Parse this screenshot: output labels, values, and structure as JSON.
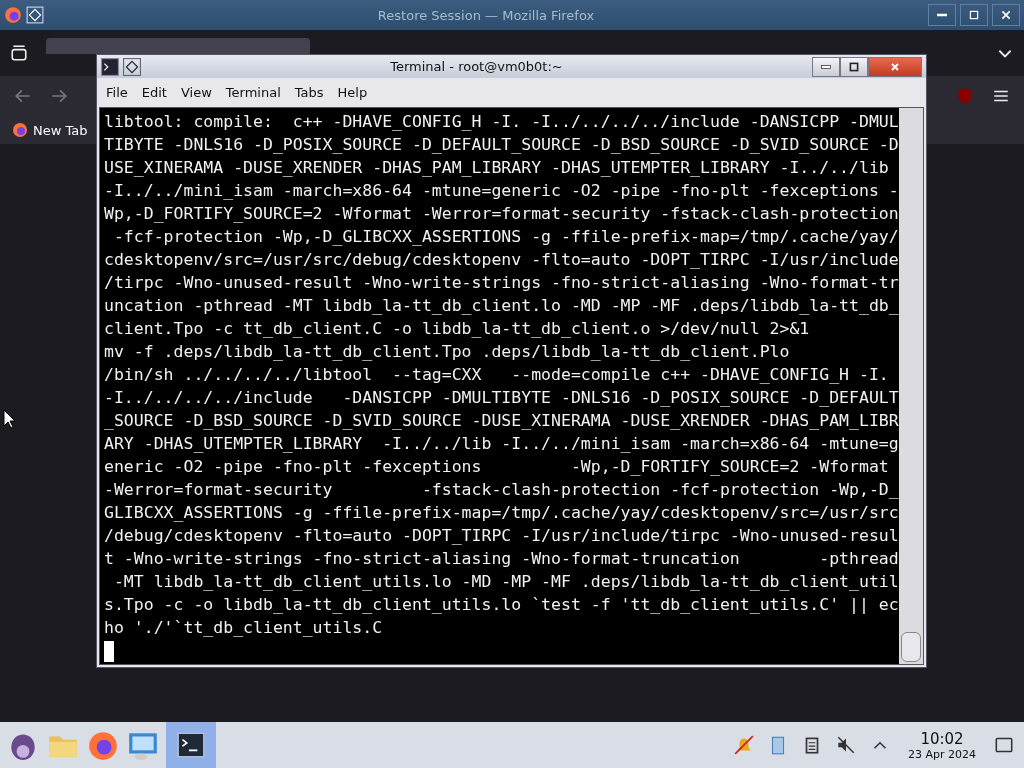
{
  "browser": {
    "title": "Restore Session — Mozilla Firefox",
    "tab": {
      "selected": true
    },
    "bookmark": "New Tab"
  },
  "terminal": {
    "title": "Terminal - root@vm0b0t:~",
    "menu": [
      "File",
      "Edit",
      "View",
      "Terminal",
      "Tabs",
      "Help"
    ],
    "lines": [
      "libtool: compile:  c++ -DHAVE_CONFIG_H -I. -I../../../../include -DANSICPP -DMUL",
      "TIBYTE -DNLS16 -D_POSIX_SOURCE -D_DEFAULT_SOURCE -D_BSD_SOURCE -D_SVID_SOURCE -D",
      "USE_XINERAMA -DUSE_XRENDER -DHAS_PAM_LIBRARY -DHAS_UTEMPTER_LIBRARY -I../../lib",
      "-I../../mini_isam -march=x86-64 -mtune=generic -O2 -pipe -fno-plt -fexceptions -",
      "Wp,-D_FORTIFY_SOURCE=2 -Wformat -Werror=format-security -fstack-clash-protection",
      " -fcf-protection -Wp,-D_GLIBCXX_ASSERTIONS -g -ffile-prefix-map=/tmp/.cache/yay/",
      "cdesktopenv/src=/usr/src/debug/cdesktopenv -flto=auto -DOPT_TIRPC -I/usr/include",
      "/tirpc -Wno-unused-result -Wno-write-strings -fno-strict-aliasing -Wno-format-tr",
      "uncation -pthread -MT libdb_la-tt_db_client.lo -MD -MP -MF .deps/libdb_la-tt_db_",
      "client.Tpo -c tt_db_client.C -o libdb_la-tt_db_client.o >/dev/null 2>&1",
      "mv -f .deps/libdb_la-tt_db_client.Tpo .deps/libdb_la-tt_db_client.Plo",
      "/bin/sh ../../../../libtool  --tag=CXX   --mode=compile c++ -DHAVE_CONFIG_H -I.",
      "-I../../../../include   -DANSICPP -DMULTIBYTE -DNLS16 -D_POSIX_SOURCE -D_DEFAULT",
      "_SOURCE -D_BSD_SOURCE -D_SVID_SOURCE -DUSE_XINERAMA -DUSE_XRENDER -DHAS_PAM_LIBR",
      "ARY -DHAS_UTEMPTER_LIBRARY  -I../../lib -I../../mini_isam -march=x86-64 -mtune=g",
      "eneric -O2 -pipe -fno-plt -fexceptions         -Wp,-D_FORTIFY_SOURCE=2 -Wformat",
      "-Werror=format-security         -fstack-clash-protection -fcf-protection -Wp,-D_",
      "GLIBCXX_ASSERTIONS -g -ffile-prefix-map=/tmp/.cache/yay/cdesktopenv/src=/usr/src",
      "/debug/cdesktopenv -flto=auto -DOPT_TIRPC -I/usr/include/tirpc -Wno-unused-resul",
      "t -Wno-write-strings -fno-strict-aliasing -Wno-format-truncation        -pthread",
      " -MT libdb_la-tt_db_client_utils.lo -MD -MP -MF .deps/libdb_la-tt_db_client_util",
      "s.Tpo -c -o libdb_la-tt_db_client_utils.lo `test -f 'tt_db_client_utils.C' || ec",
      "ho './'`tt_db_client_utils.C"
    ]
  },
  "taskbar": {
    "time": "10:02",
    "date": "23 Apr 2024"
  }
}
